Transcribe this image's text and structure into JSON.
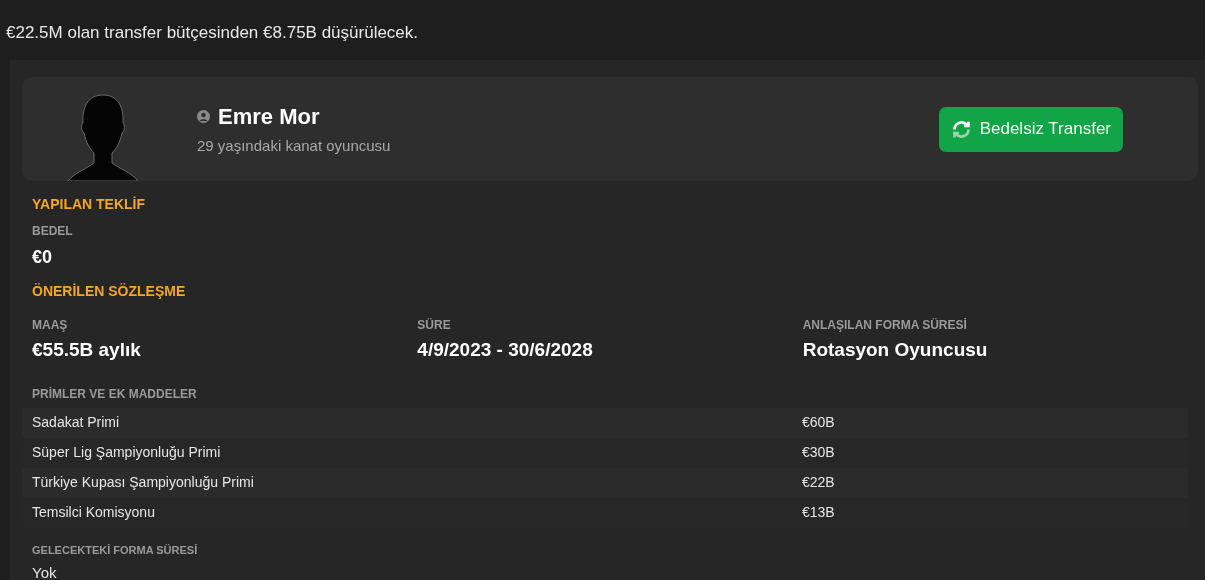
{
  "notice": "€22.5M olan transfer bütçesinden €8.75B düşürülecek.",
  "player": {
    "name": "Emre Mor",
    "subtitle": "29 yaşındaki kanat oyuncusu",
    "action": "Bedelsiz Transfer"
  },
  "offer": {
    "title": "YAPILAN TEKLİF",
    "fee_label": "BEDEL",
    "fee": "€0"
  },
  "contract": {
    "title": "ÖNERİLEN SÖZLEŞME",
    "fields": [
      {
        "label": "MAAŞ",
        "value": "€55.5B aylık"
      },
      {
        "label": "SÜRE",
        "value": "4/9/2023 - 30/6/2028"
      },
      {
        "label": "ANLAŞILAN FORMA SÜRESİ",
        "value": "Rotasyon Oyuncusu"
      }
    ],
    "bonuses_label": "PRİMLER VE EK MADDELER",
    "bonuses": [
      {
        "name": "Sadakat Primi",
        "value": "€60B"
      },
      {
        "name": "Süper Lig Şampiyonluğu Primi",
        "value": "€30B"
      },
      {
        "name": "Türkiye Kupası Şampiyonluğu Primi",
        "value": "€22B"
      },
      {
        "name": "Temsilci Komisyonu",
        "value": "€13B"
      }
    ],
    "future_label": "GELECEKTEKİ FORMA SÜRESİ",
    "future": "Yok"
  }
}
